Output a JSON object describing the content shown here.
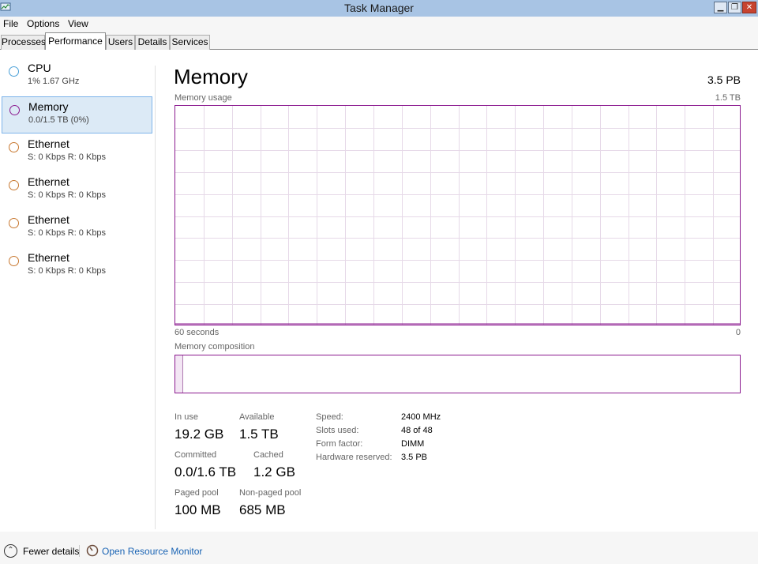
{
  "window": {
    "title": "Task Manager",
    "minimize_glyph": "▁",
    "maximize_glyph": "❐",
    "close_glyph": "✕"
  },
  "menu": {
    "items": [
      "File",
      "Options",
      "View"
    ]
  },
  "tabs": [
    "Processes",
    "Performance",
    "Users",
    "Details",
    "Services"
  ],
  "active_tab": "Performance",
  "sidebar": {
    "items": [
      {
        "name": "CPU",
        "detail": "1% 1.67 GHz",
        "circle_color": "#4aa0d8",
        "selected": false
      },
      {
        "name": "Memory",
        "detail": "0.0/1.5 TB (0%)",
        "circle_color": "#8b1a8f",
        "selected": true
      },
      {
        "name": "Ethernet",
        "detail": "S: 0 Kbps R: 0 Kbps",
        "circle_color": "#c87830",
        "selected": false
      },
      {
        "name": "Ethernet",
        "detail": "S: 0 Kbps R: 0 Kbps",
        "circle_color": "#c87830",
        "selected": false
      },
      {
        "name": "Ethernet",
        "detail": "S: 0 Kbps R: 0 Kbps",
        "circle_color": "#c87830",
        "selected": false
      },
      {
        "name": "Ethernet",
        "detail": "S: 0 Kbps R: 0 Kbps",
        "circle_color": "#c87830",
        "selected": false
      }
    ]
  },
  "main": {
    "title": "Memory",
    "total": "3.5 PB",
    "graph_label": "Memory usage",
    "graph_max": "1.5 TB",
    "graph_time_left": "60 seconds",
    "graph_time_right": "0",
    "composition_label": "Memory composition",
    "stats": {
      "in_use_label": "In use",
      "in_use_value": "19.2 GB",
      "available_label": "Available",
      "available_value": "1.5 TB",
      "committed_label": "Committed",
      "committed_value": "0.0/1.6 TB",
      "cached_label": "Cached",
      "cached_value": "1.2 GB",
      "paged_label": "Paged pool",
      "paged_value": "100 MB",
      "nonpaged_label": "Non-paged pool",
      "nonpaged_value": "685 MB"
    },
    "specs": [
      {
        "label": "Speed:",
        "value": "2400 MHz"
      },
      {
        "label": "Slots used:",
        "value": "48 of 48"
      },
      {
        "label": "Form factor:",
        "value": "DIMM"
      },
      {
        "label": "Hardware reserved:",
        "value": "3.5 PB"
      }
    ]
  },
  "footer": {
    "fewer_details": "Fewer details",
    "fewer_glyph": "⌃",
    "open_monitor": "Open Resource Monitor"
  },
  "colors": {
    "accent_memory": "#8b1a8f",
    "selection_bg": "#dceaf6",
    "link": "#1a64b4"
  }
}
